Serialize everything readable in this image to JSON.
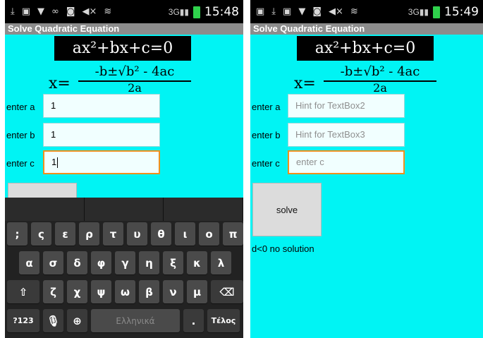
{
  "left": {
    "status_time": "15:48",
    "app_title": "Solve Quadratic Equation",
    "equation": "ax²+bx+c=0",
    "formula": {
      "x": "x=",
      "numerator": "-b±√b² - 4ac",
      "denominator": "2a"
    },
    "fields": [
      {
        "label": "enter a",
        "value": "1"
      },
      {
        "label": "enter b",
        "value": "1"
      },
      {
        "label": "enter c",
        "value": "1"
      }
    ],
    "keyboard": {
      "row1": [
        ";",
        "ς",
        "ε",
        "ρ",
        "τ",
        "υ",
        "θ",
        "ι",
        "ο",
        "π"
      ],
      "row2": [
        "α",
        "σ",
        "δ",
        "φ",
        "γ",
        "η",
        "ξ",
        "κ",
        "λ"
      ],
      "row3": [
        "ζ",
        "χ",
        "ψ",
        "ω",
        "β",
        "ν",
        "μ"
      ],
      "mode_key": "?123",
      "space_label": "Ελληνικά",
      "period": ".",
      "enter_label": "Τέλος"
    }
  },
  "right": {
    "status_time": "15:49",
    "app_title": "Solve Quadratic Equation",
    "equation": "ax²+bx+c=0",
    "formula": {
      "x": "x=",
      "numerator": "-b±√b² - 4ac",
      "denominator": "2a"
    },
    "fields": [
      {
        "label": "enter a",
        "placeholder": "Hint for TextBox2"
      },
      {
        "label": "enter b",
        "placeholder": "Hint for TextBox3"
      },
      {
        "label": "enter c",
        "placeholder": "enter c"
      }
    ],
    "solve_label": "solve",
    "result": "d<0  no solution"
  },
  "colors": {
    "background": "#00f4f4",
    "focus": "#f0901e",
    "title_bar": "#8c8c8c"
  }
}
